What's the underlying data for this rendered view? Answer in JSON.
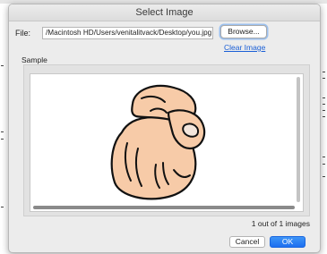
{
  "dialog": {
    "title": "Select Image",
    "file_label": "File:",
    "file_path": "/Macintosh HD/Users/venitalitvack/Desktop/you.jpg",
    "browse_label": "Browse...",
    "clear_label": "Clear Image",
    "sample_label": "Sample",
    "sample_icon": "pointing-hand-icon",
    "image_counter": "1 out of 1 images",
    "cancel_label": "Cancel",
    "ok_label": "OK"
  },
  "colors": {
    "accent": "#1d6ff0",
    "link": "#1a5fd6",
    "skin": "#f7cba8",
    "dialog_bg": "#ececec"
  }
}
